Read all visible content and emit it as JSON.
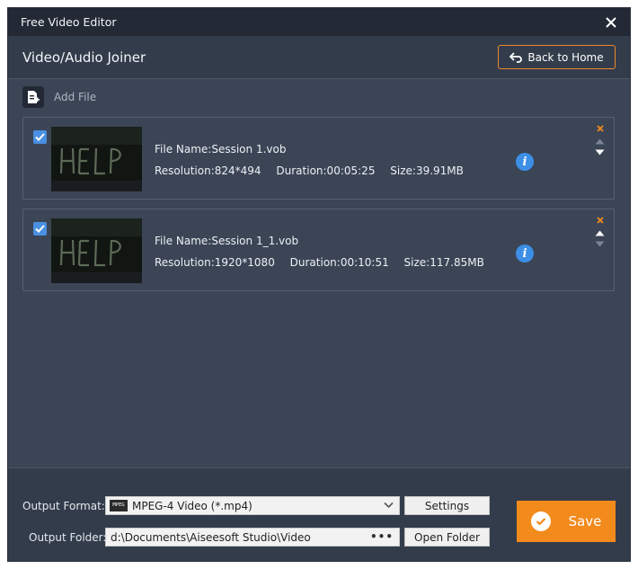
{
  "window": {
    "title": "Free Video Editor"
  },
  "header": {
    "title": "Video/Audio Joiner",
    "back_label": "Back to Home"
  },
  "toolbar": {
    "add_file_label": "Add File"
  },
  "files": [
    {
      "checked": true,
      "file_name": "File Name:Session 1.vob",
      "resolution": "Resolution:824*494",
      "duration": "Duration:00:05:25",
      "size": "Size:39.91MB"
    },
    {
      "checked": true,
      "file_name": "File Name:Session 1_1.vob",
      "resolution": "Resolution:1920*1080",
      "duration": "Duration:00:10:51",
      "size": "Size:117.85MB"
    }
  ],
  "output": {
    "format_label": "Output Format:",
    "format_value": "MPEG-4 Video (*.mp4)",
    "format_icon_text": "MPEG",
    "folder_label": "Output Folder:",
    "folder_value": "d:\\Documents\\Aiseesoft Studio\\Video",
    "browse_label": "•••",
    "settings_label": "Settings",
    "open_folder_label": "Open Folder",
    "save_label": "Save"
  },
  "colors": {
    "accent": "#f28a1c",
    "info": "#3d8fe6",
    "check": "#4a90e2",
    "background": "#3b4556"
  },
  "icons": [
    "close-icon",
    "back-arrow-icon",
    "add-file-icon",
    "checkbox-icon",
    "info-icon",
    "remove-icon",
    "move-up-icon",
    "move-down-icon",
    "chevron-down-icon",
    "save-check-icon"
  ]
}
